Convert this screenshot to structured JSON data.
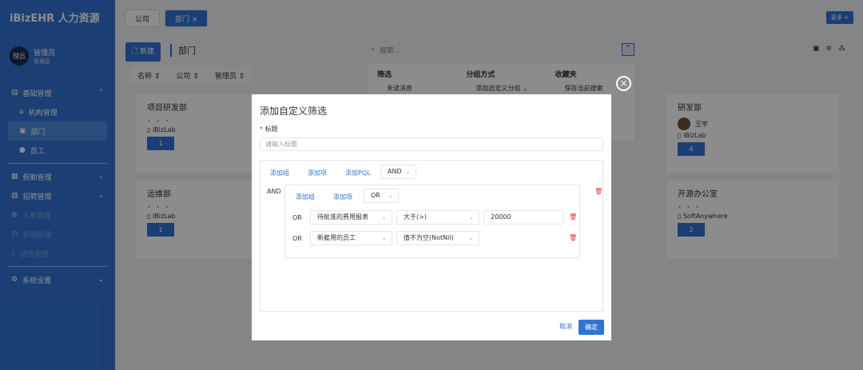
{
  "app": {
    "title": "iBizEHR 人力资源"
  },
  "user": {
    "avatar": "理员",
    "name": "管理员",
    "role": "管理员"
  },
  "menu": [
    {
      "label": "基础管理",
      "icon": "folder-icon",
      "expanded": true
    },
    {
      "label": "机构管理",
      "icon": "bank-icon",
      "sub": true
    },
    {
      "label": "部门",
      "icon": "department-icon",
      "sub": true,
      "active": true
    },
    {
      "label": "员工",
      "icon": "person-icon",
      "sub": true
    },
    {
      "label": "假勤管理",
      "icon": "calendar-icon"
    },
    {
      "label": "招聘管理",
      "icon": "recruit-icon"
    },
    {
      "label": "人事管理",
      "icon": "person-icon",
      "faded": true
    },
    {
      "label": "薪酬管理",
      "icon": "money-icon",
      "faded": true
    },
    {
      "label": "绩效管理",
      "icon": "chart-icon",
      "faded": true
    },
    {
      "label": "系统设置",
      "icon": "gear-icon"
    }
  ],
  "tabs": [
    {
      "label": "公司"
    },
    {
      "label": "部门 ×"
    }
  ],
  "more_label": "更多 +",
  "toolbar": {
    "new_label": "新建",
    "page_title": "部门",
    "search_placeholder": "搜索..."
  },
  "sorts": [
    "名称 ⇕",
    "公司 ⇕",
    "管理员 ⇕"
  ],
  "filter_panel": {
    "filter": "筛选",
    "filter_item": "未读消息",
    "group": "分组方式",
    "group_item": "添加自定义分组 ⌄",
    "fav": "收藏夹",
    "fav_item": "保存当前搜索"
  },
  "cards": [
    {
      "name": "项目研发部",
      "company": "iBizLab",
      "count": "1"
    },
    {
      "name": "运维部",
      "company": "iBizLab",
      "count": "1"
    },
    {
      "name": "研发部",
      "manager": "王宇",
      "company": "iBizLab",
      "count": "4"
    },
    {
      "name": "开源办公室",
      "company": "SoftAnywhere",
      "count": "2"
    }
  ],
  "modal": {
    "title": "添加自定义筛选",
    "label": "标题",
    "placeholder": "请输入标题",
    "add_group": "添加组",
    "add_item": "添加项",
    "add_pql": "添加PQL",
    "root_op": "AND",
    "and_label": "AND",
    "group_op": "OR",
    "conditions": [
      {
        "join": "OR",
        "field": "待批准的费用报表",
        "op": "大于(>)",
        "value": "20000"
      },
      {
        "join": "OR",
        "field": "新雇用的员工",
        "op": "值不为空(NotNil)",
        "value": ""
      }
    ],
    "cancel": "取消",
    "ok": "确定"
  }
}
